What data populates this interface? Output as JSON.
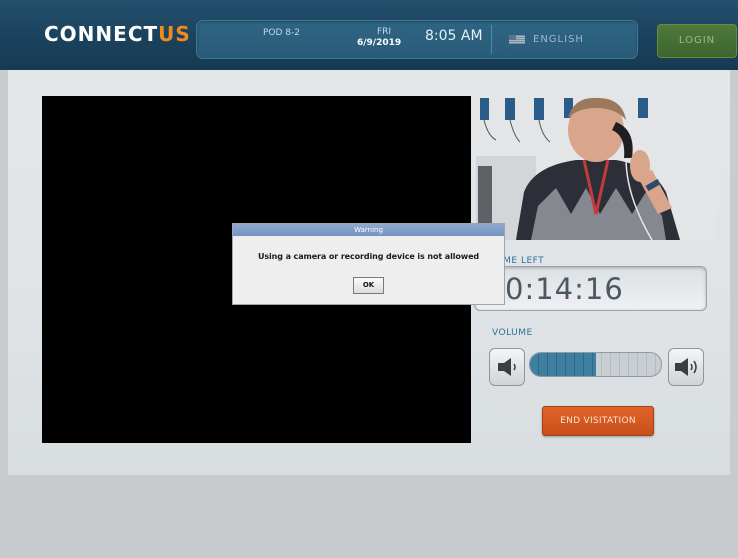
{
  "header": {
    "logo": {
      "main": "CONNECT",
      "accent": "US"
    },
    "pod": "POD 8-2",
    "day": "FRI",
    "date": "6/9/2019",
    "time": "8:05 AM",
    "language": "ENGLISH",
    "flag_icon": "us-flag-icon",
    "login_label": "LOGIN"
  },
  "visitation": {
    "time_left_label": "TIME LEFT",
    "timer": "0:14:16",
    "volume_label": "VOLUME",
    "volume_level": 0.5,
    "volume_down_icon": "speaker-low-icon",
    "volume_up_icon": "speaker-high-icon",
    "end_label": "END VISITATION"
  },
  "dialog": {
    "title": "Warning",
    "message": "Using a camera or recording device is not allowed",
    "ok_label": "OK"
  },
  "colors": {
    "brand_accent": "#f08a1c",
    "header_bg": "#1b425d",
    "end_button": "#d9582a",
    "login_button": "#4a7436"
  }
}
